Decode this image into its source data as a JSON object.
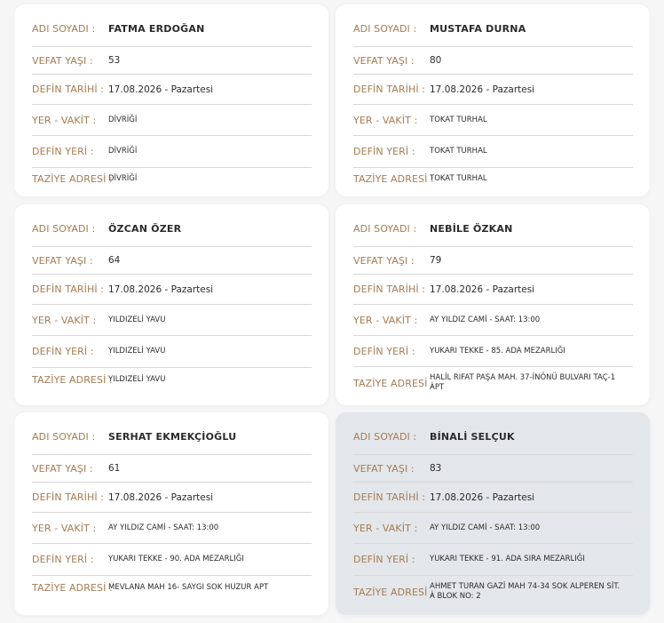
{
  "labels": {
    "name": "ADI SOYADI :",
    "age": "VEFAT YAŞI :",
    "date": "DEFİN TARİHİ :",
    "place_time": "YER - VAKİT :",
    "burial": "DEFİN YERİ :",
    "address": "TAZİYE ADRESİ :"
  },
  "cards": [
    {
      "name": "FATMA ERDOĞAN",
      "age": "53",
      "date": "17.08.2026 - Pazartesi",
      "place_time": "DİVRİĞİ",
      "burial": "DİVRİĞİ",
      "address": "DİVRİĞİ"
    },
    {
      "name": "MUSTAFA DURNA",
      "age": "80",
      "date": "17.08.2026 - Pazartesi",
      "place_time": "TOKAT TURHAL",
      "burial": "TOKAT TURHAL",
      "address": "TOKAT TURHAL"
    },
    {
      "name": "ÖZCAN ÖZER",
      "age": "64",
      "date": "17.08.2026 - Pazartesi",
      "place_time": "YILDIZELİ YAVU",
      "burial": "YILDIZELİ YAVU",
      "address": "YILDIZELİ YAVU"
    },
    {
      "name": "NEBİLE ÖZKAN",
      "age": "79",
      "date": "17.08.2026 - Pazartesi",
      "place_time": "AY YILDIZ CAMİ - SAAT: 13:00",
      "burial": "YUKARI TEKKE - 85. ADA MEZARLIĞI",
      "address": "HALİL RIFAT PAŞA MAH. 37-İNÖNÜ BULVARI TAÇ-1 APT"
    },
    {
      "name": "SERHAT EKMEKÇİOĞLU",
      "age": "61",
      "date": "17.08.2026 - Pazartesi",
      "place_time": "AY YILDIZ CAMİ - SAAT: 13:00",
      "burial": "YUKARI TEKKE - 90. ADA MEZARLIĞI",
      "address": "MEVLANA MAH 16- SAYGI SOK HUZUR APT"
    },
    {
      "name": "BİNALİ SELÇUK",
      "age": "83",
      "date": "17.08.2026 - Pazartesi",
      "place_time": "AY YILDIZ CAMİ - SAAT: 13:00",
      "burial": "YUKARI TEKKE - 91. ADA SIRA MEZARLIĞI",
      "address": "AHMET TURAN GAZİ MAH 74-34 SOK ALPEREN SİT. A BLOK NO: 2"
    }
  ]
}
